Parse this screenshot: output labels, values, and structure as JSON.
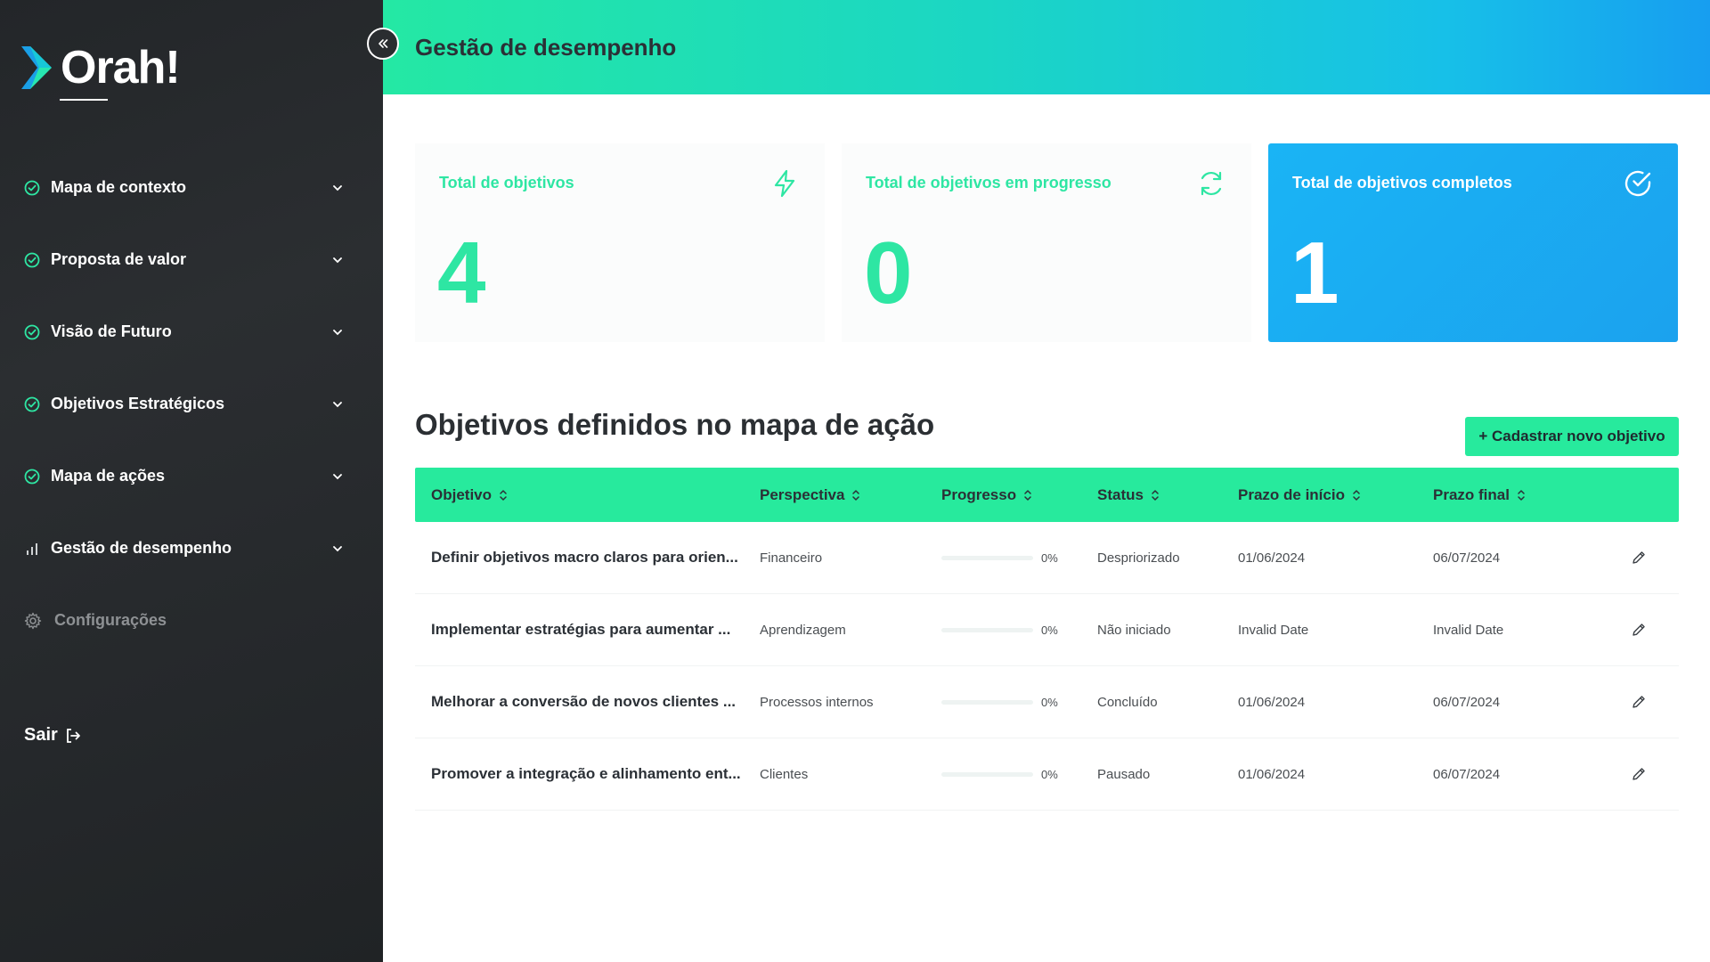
{
  "brand": {
    "name": "Orah!"
  },
  "sidebar": {
    "items": [
      {
        "label": "Mapa de contexto",
        "icon": "check-circle-icon"
      },
      {
        "label": "Proposta de valor",
        "icon": "check-circle-icon"
      },
      {
        "label": "Visão de Futuro",
        "icon": "check-circle-icon"
      },
      {
        "label": "Objetivos Estratégicos",
        "icon": "check-circle-icon"
      },
      {
        "label": "Mapa de ações",
        "icon": "check-circle-icon"
      },
      {
        "label": "Gestão de desempenho",
        "icon": "bar-chart-icon"
      }
    ],
    "settings_label": "Configurações",
    "logout_label": "Sair"
  },
  "header": {
    "title": "Gestão de desempenho"
  },
  "cards": [
    {
      "title": "Total de objetivos",
      "value": "4",
      "icon": "lightning-icon"
    },
    {
      "title": "Total de objetivos em progresso",
      "value": "0",
      "icon": "refresh-icon"
    },
    {
      "title": "Total de objetivos completos",
      "value": "1",
      "icon": "check-circle-icon"
    }
  ],
  "section": {
    "title": "Objetivos definidos no mapa de ação",
    "add_button": "+ Cadastrar novo objetivo"
  },
  "table": {
    "columns": [
      "Objetivo",
      "Perspectiva",
      "Progresso",
      "Status",
      "Prazo de início",
      "Prazo final"
    ],
    "rows": [
      {
        "objetivo": "Definir objetivos macro claros para orien...",
        "perspectiva": "Financeiro",
        "progresso": 0,
        "progresso_label": "0%",
        "status": "Despriorizado",
        "inicio": "01/06/2024",
        "final": "06/07/2024"
      },
      {
        "objetivo": "Implementar estratégias para aumentar ...",
        "perspectiva": "Aprendizagem",
        "progresso": 0,
        "progresso_label": "0%",
        "status": "Não iniciado",
        "inicio": "Invalid Date",
        "final": "Invalid Date"
      },
      {
        "objetivo": "Melhorar a conversão de novos clientes ...",
        "perspectiva": "Processos internos",
        "progresso": 0,
        "progresso_label": "0%",
        "status": "Concluído",
        "inicio": "01/06/2024",
        "final": "06/07/2024"
      },
      {
        "objetivo": "Promover a integração e alinhamento ent...",
        "perspectiva": "Clientes",
        "progresso": 0,
        "progresso_label": "0%",
        "status": "Pausado",
        "inicio": "01/06/2024",
        "final": "06/07/2024"
      }
    ]
  },
  "colors": {
    "accent": "#27ea9d",
    "highlight_card": "#1ba8f2",
    "sidebar": "#26292c"
  }
}
